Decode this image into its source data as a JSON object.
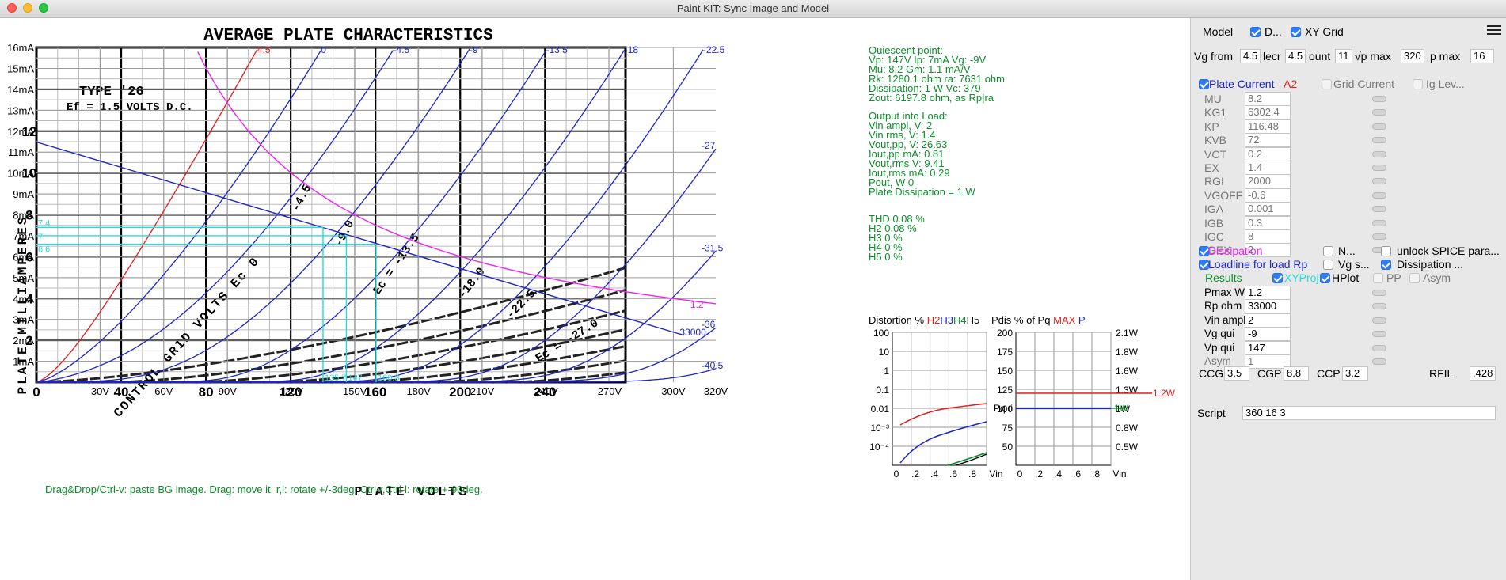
{
  "window": {
    "title": "Paint KIT: Sync Image and Model"
  },
  "chart_data": {
    "type": "line",
    "title": "AVERAGE PLATE CHARACTERISTICS",
    "xlabel": "PLATE VOLTS",
    "ylabel": "PLATE MILLIAMPERES",
    "subtitle_lines": [
      "TYPE '26",
      "Ef = 1.5 VOLTS D.C."
    ],
    "control_grid_label": "CONTROL GRID VOLTS Ec 0",
    "xlim": [
      0,
      320
    ],
    "ylim": [
      0,
      16
    ],
    "x_ticks_model": [
      "30V",
      "60V",
      "90V",
      "120V",
      "150V",
      "180V",
      "210V",
      "240V",
      "270V",
      "300V",
      "320V"
    ],
    "x_ticks_paper": [
      "0",
      "40",
      "80",
      "120",
      "160",
      "200",
      "240"
    ],
    "y_ticks": [
      "1mA",
      "2mA",
      "3mA",
      "4mA",
      "5mA",
      "6mA",
      "7mA",
      "8mA",
      "9mA",
      "10mA",
      "11mA",
      "12mA",
      "13mA",
      "14mA",
      "15mA",
      "16mA"
    ],
    "y_ticks_paper": [
      "2",
      "4",
      "6",
      "8",
      "10",
      "12"
    ],
    "paper_curve_labels": [
      "-4.5",
      "-9.0",
      "Ec = -13.5",
      "-18.0",
      "-22.5",
      "Ec = -27.0"
    ],
    "grid_curves": [
      {
        "vg": "4.5",
        "mu": 8.2,
        "color": "#e21b1b"
      },
      {
        "vg": "0",
        "mu": 8.2,
        "color": "#1f24c9"
      },
      {
        "vg": "-4.5",
        "mu": 8.2,
        "color": "#1f24c9"
      },
      {
        "vg": "-9",
        "mu": 8.2,
        "color": "#1f24c9"
      },
      {
        "vg": "-13.5",
        "mu": 8.2,
        "color": "#1f24c9"
      },
      {
        "vg": "-18",
        "mu": 8.2,
        "color": "#1f24c9"
      },
      {
        "vg": "-22.5",
        "mu": 8.2,
        "color": "#1f24c9"
      },
      {
        "vg": "-27",
        "mu": 8.2,
        "color": "#1f24c9"
      },
      {
        "vg": "-31.5",
        "mu": 8.2,
        "color": "#1f24c9"
      },
      {
        "vg": "-36",
        "mu": 8.2,
        "color": "#1f24c9"
      },
      {
        "vg": "-40.5",
        "mu": 8.2,
        "color": "#1f24c9"
      }
    ],
    "curve_kp": 116.48,
    "curve_ex": 1.4,
    "dissipation_w": 1.2,
    "dissipation_label": "1.2",
    "loadline": {
      "v0": 379,
      "i0": 11.48,
      "label": "33000"
    },
    "operating": {
      "vin_mark": [
        135,
        146,
        160
      ],
      "labels": [
        "135.7",
        "147",
        "160.3"
      ],
      "i_marks": [
        7.4,
        7.0,
        6.6
      ],
      "i_labels": [
        "7.4",
        "7",
        "6.6"
      ]
    }
  },
  "info": {
    "quiescent": [
      "Quiescent point:",
      "Vp: 147V  Ip: 7mA  Vg: -9V",
      "Mu: 8.2 Gm: 1.1 mA/V",
      "Rk: 1280.1 ohm ra: 7631 ohm",
      "Dissipation: 1 W Vc: 379",
      "Zout: 6197.8 ohm, as Rp|ra"
    ],
    "output": [
      "Output into Load:",
      "Vin ampl, V: 2",
      "Vin rms,  V: 1.4",
      "Vout,pp,   V: 26.63",
      "Iout,pp   mA: 0.81",
      "Vout,rms  V: 9.41",
      "Iout,rms  mA: 0.29",
      "Pout, W      0",
      "Plate Dissipation = 1 W"
    ],
    "thd": [
      "THD 0.08 %",
      "  H2 0.08 %",
      "  H3 0 %",
      "  H4 0 %",
      "  H5 0 %"
    ],
    "hint": "Drag&Drop/Ctrl-v: paste BG image. Drag: move it. r,l: rotate +/-3deg. Ctrl-r,Ctrl-l: rotate +-90deg."
  },
  "distortion": {
    "title_prefix": "Distortion %",
    "h2": "H2",
    "h3": "H3",
    "h4": "H4",
    "h5": "H5",
    "y_ticks": [
      "100",
      "10",
      "1",
      "0.1",
      "0.01",
      "10⁻³",
      "10⁻⁴"
    ],
    "x_ticks": [
      "0",
      ".2",
      ".4",
      ".6",
      ".8",
      "Vin"
    ]
  },
  "pdis": {
    "title_prefix": "Pdis % of Pq",
    "max_label": "MAX",
    "p_label": "P",
    "left_ticks": [
      "200",
      "175",
      "150",
      "125",
      "100",
      "75",
      "50"
    ],
    "right_ticks": [
      "2.1W",
      "1.8W",
      "1.6W",
      "1.3W",
      "1W",
      "0.8W",
      "0.5W"
    ],
    "pqui": "Pqui",
    "max_val": "1.2W",
    "pq_val": "1W",
    "x_ticks": [
      "0",
      ".2",
      ".4",
      ".6",
      ".8",
      "Vin"
    ]
  },
  "panel": {
    "model_label": "Model",
    "d_label": "D...",
    "xygrid_label": "XY Grid",
    "vg_from_label": "Vg from",
    "vg_from": "4.5",
    "decr_label": "lecr",
    "decr": "4.5",
    "count_label": "ount",
    "count": "11",
    "vpmax_label": "√p max",
    "vpmax": "320",
    "ipmax_label": "p max",
    "ipmax": "16",
    "plate_current": "Plate Current",
    "a2": "A2",
    "grid_current": "Grid Current",
    "ig_lev": "Ig Lev...",
    "params": [
      {
        "name": "MU",
        "value": "8.2"
      },
      {
        "name": "KG1",
        "value": "6302.4"
      },
      {
        "name": "KP",
        "value": "116.48"
      },
      {
        "name": "KVB",
        "value": "72"
      },
      {
        "name": "VCT",
        "value": "0.2"
      },
      {
        "name": "EX",
        "value": "1.4"
      },
      {
        "name": "RGI",
        "value": "2000"
      },
      {
        "name": "VGOFF",
        "value": "-0.6"
      },
      {
        "name": "IGA",
        "value": "0.001"
      },
      {
        "name": "IGB",
        "value": "0.3"
      },
      {
        "name": "IGC",
        "value": "8"
      },
      {
        "name": "IGEX",
        "value": "2"
      }
    ],
    "dissipation": "Dissipation",
    "n_label": "N...",
    "unlock": "unlock SPICE para...",
    "loadline": "Loadline for load Rp",
    "vg_s": "Vg s...",
    "dissipation2": "Dissipation ...",
    "results": "Results",
    "xyproj": "XYProj",
    "hplot": "HPlot",
    "pp": "PP",
    "asym_cb": "Asym",
    "results_rows": [
      {
        "name": "Pmax W",
        "value": "1.2"
      },
      {
        "name": "Rp ohm",
        "value": "33000"
      },
      {
        "name": "Vin ampl",
        "value": "2"
      },
      {
        "name": "Vg qui",
        "value": "-9"
      },
      {
        "name": "Vp qui",
        "value": "147"
      },
      {
        "name": "Asym",
        "value": "1"
      }
    ],
    "ccg_label": "CCG",
    "ccg": "3.5",
    "cgp_label": "CGP",
    "cgp": "8.8",
    "ccp_label": "CCP",
    "ccp": "3.2",
    "rfil_label": "RFIL",
    "rfil": ".428",
    "script_label": "Script",
    "script": "360 16 3"
  },
  "colors": {
    "model": "#1f24c9",
    "positive": "#e21b1b",
    "dissipation": "#ee22ee",
    "proj": "#22dddd",
    "info": "#0c8d2a"
  }
}
